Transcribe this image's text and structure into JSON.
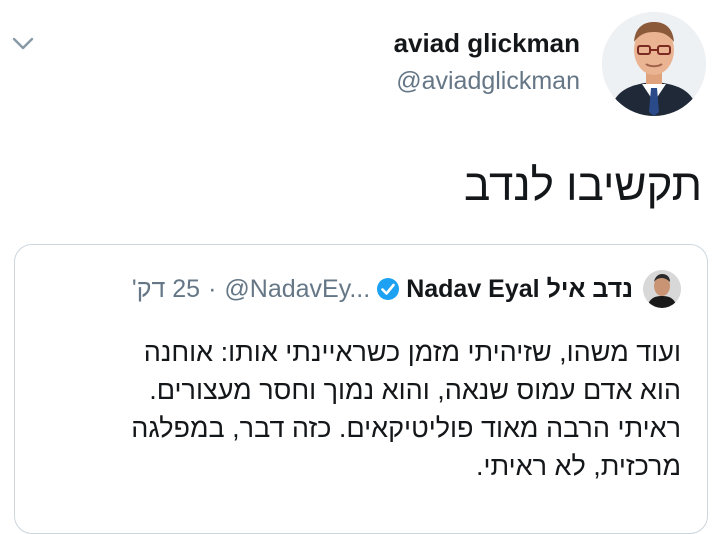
{
  "author": {
    "name": "aviad glickman",
    "handle": "@aviadglickman"
  },
  "tweet": {
    "text": "תקשיבו לנדב"
  },
  "quoted": {
    "name": "נדב איל Nadav Eyal",
    "handle": "@NadavEy...",
    "separator": "·",
    "time": "25 דק'",
    "lines": [
      "ועוד משהו, שזיהיתי מזמן כשראיינתי אותו: אוחנה",
      "הוא אדם עמוס שנאה, והוא נמוך וחסר מעצורים.",
      "ראיתי הרבה מאוד פוליטיקאים. כזה דבר, במפלגה",
      "מרכזית, לא ראיתי."
    ]
  },
  "colors": {
    "text": "#14171a",
    "secondary": "#657786",
    "border": "#ccd6dd",
    "verified": "#1da1f2"
  },
  "icons": {
    "menu": "chevron-down-icon",
    "verified": "verified-badge-icon"
  }
}
